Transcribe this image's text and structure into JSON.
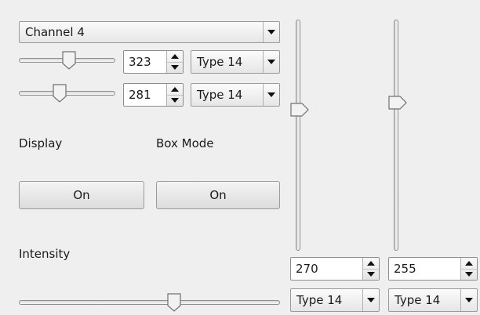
{
  "channel_select": {
    "value": "Channel 4"
  },
  "row1": {
    "spin_value": "323",
    "type_value": "Type 14",
    "slider_level": 0.52
  },
  "row2": {
    "spin_value": "281",
    "type_value": "Type 14",
    "slider_level": 0.41
  },
  "labels": {
    "display": "Display",
    "box_mode": "Box Mode",
    "intensity": "Intensity"
  },
  "buttons": {
    "display_on": "On",
    "box_mode_on": "On"
  },
  "intensity_slider_level": 0.6,
  "vertical_slider_left": {
    "level": 0.62,
    "spin_value": "270",
    "type_value": "Type 14"
  },
  "vertical_slider_right": {
    "level": 0.65,
    "spin_value": "255",
    "type_value": "Type 14"
  }
}
